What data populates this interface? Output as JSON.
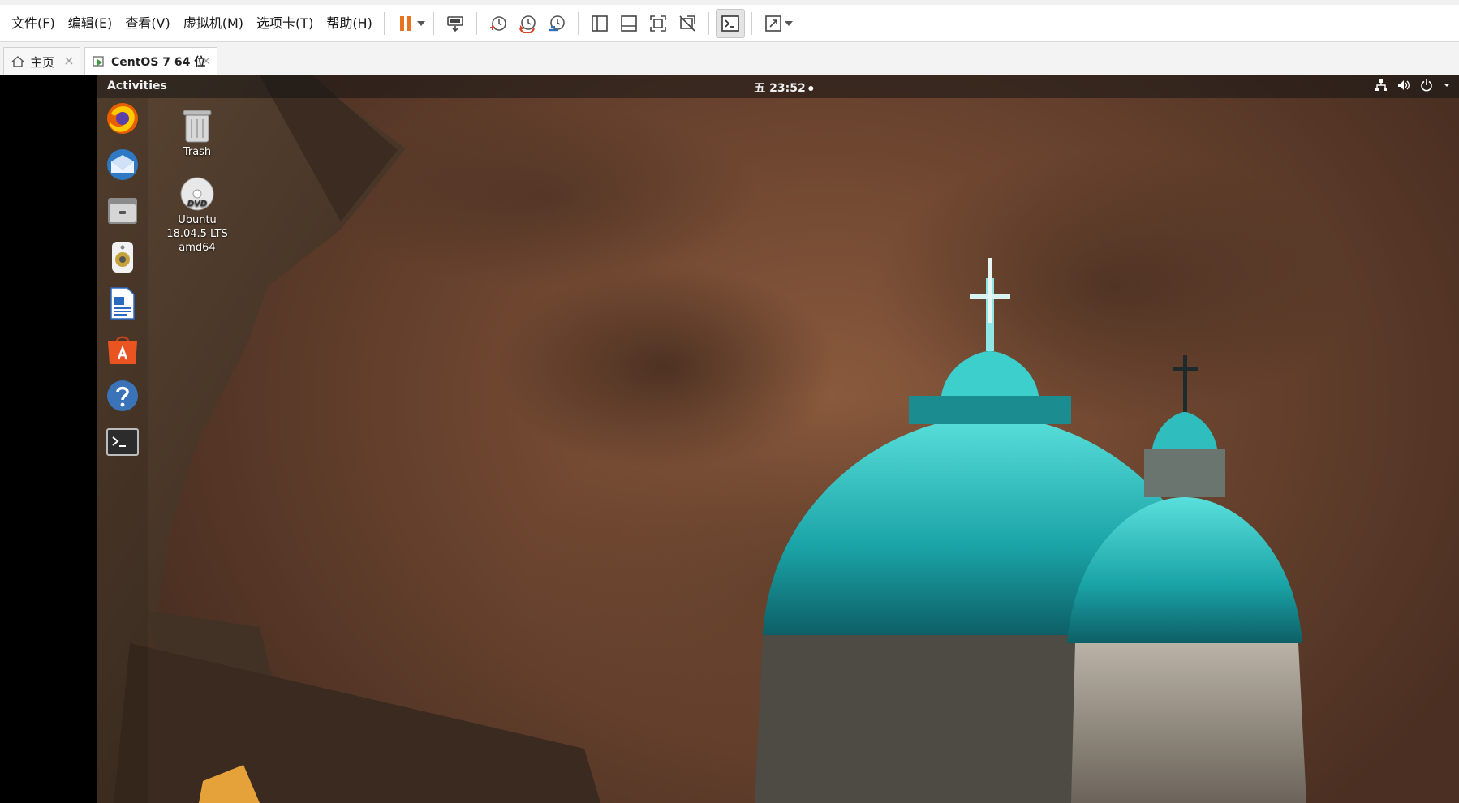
{
  "menu": {
    "items": [
      "文件(F)",
      "编辑(E)",
      "查看(V)",
      "虚拟机(M)",
      "选项卡(T)",
      "帮助(H)"
    ]
  },
  "toolbar": {
    "icons": [
      "pause-icon",
      "send-ctrl-alt-del-icon",
      "snapshot-icon",
      "revert-snapshot-icon",
      "snapshot-manager-icon",
      "library-icon",
      "thumbnail-bar-icon",
      "fit-guest-icon",
      "unity-off-icon",
      "console-view-icon",
      "fullscreen-icon"
    ],
    "colors": {
      "pause": "#e8731e",
      "accent_red": "#d9442b",
      "accent_blue": "#2f6fb3"
    }
  },
  "tabs": [
    {
      "label": "主页",
      "active": false
    },
    {
      "label": "CentOS 7 64 位",
      "active": true
    }
  ],
  "guest": {
    "topbar": {
      "activities": "Activities",
      "clock": "五 23:52"
    },
    "dock": [
      "firefox-icon",
      "thunderbird-icon",
      "files-icon",
      "rhythmbox-icon",
      "libreoffice-writer-icon",
      "software-center-icon",
      "help-icon",
      "terminal-icon"
    ],
    "desktop_icons": [
      {
        "label": "Trash"
      },
      {
        "label_lines": [
          "Ubuntu",
          "18.04.5 LTS",
          "amd64"
        ]
      }
    ]
  }
}
